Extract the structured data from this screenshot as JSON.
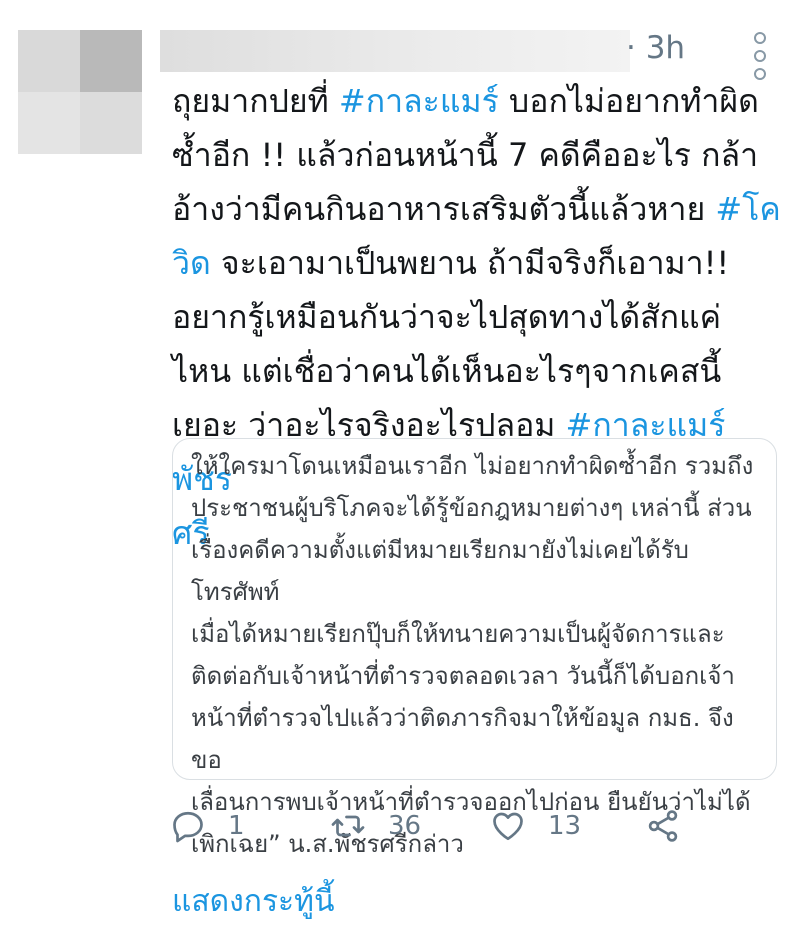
{
  "meta": {
    "time": "· 3h"
  },
  "tweet": {
    "segments": [
      {
        "text": "ถุยมากปยที่ ",
        "tag": false
      },
      {
        "text": "#กาละแมร์",
        "tag": true
      },
      {
        "text": " บอกไม่อยากทำผิด\nซ้ำอีก !! แล้วก่อนหน้านี้ 7 คดีคืออะไร กล้า\nอ้างว่ามีคนกินอาหารเสริมตัวนี้แล้วหาย ",
        "tag": false
      },
      {
        "text": "#โค\nวิด",
        "tag": true
      },
      {
        "text": " จะเอามาเป็นพยาน ถ้ามีจริงก็เอามา!!\nอยากรู้เหมือนกันว่าจะไปสุดทางได้สักแค่\nไหน แต่เชื่อว่าคนได้เห็นอะไรๆจากเคสนี้\nเยอะ ว่าอะไรจริงอะไรปลอม ",
        "tag": false
      },
      {
        "text": "#กาละแมร์พัชร\nศรี",
        "tag": true
      }
    ]
  },
  "quote": {
    "text": "ให้ใครมาโดนเหมือนเราอีก ไม่อยากทำผิดซ้ำอีก รวมถึง\nประชาชนผู้บริโภคจะได้รู้ข้อกฎหมายต่างๆ เหล่านี้ ส่วน\nเรื่องคดีความตั้งแต่มีหมายเรียกมายังไม่เคยได้รับโทรศัพท์\nเมื่อได้หมายเรียกปุ๊บก็ให้ทนายความเป็นผู้จัดการและ\nติดต่อกับเจ้าหน้าที่ตำรวจตลอดเวลา วันนี้ก็ได้บอกเจ้า\nหน้าที่ตำรวจไปแล้วว่าติดภารกิจมาให้ข้อมูล กมธ. จึงขอ\nเลื่อนการพบเจ้าหน้าที่ตำรวจออกไปก่อน ยืนยันว่าไม่ได้\nเพิกเฉย” น.ส.พัชรศรีกล่าว"
  },
  "actions": {
    "reply_count": "1",
    "retweet_count": "36",
    "like_count": "13"
  },
  "footer": {
    "show_thread": "แสดงกระทู้นี้"
  },
  "colors": {
    "accent": "#1b95e0",
    "muted": "#657786"
  }
}
